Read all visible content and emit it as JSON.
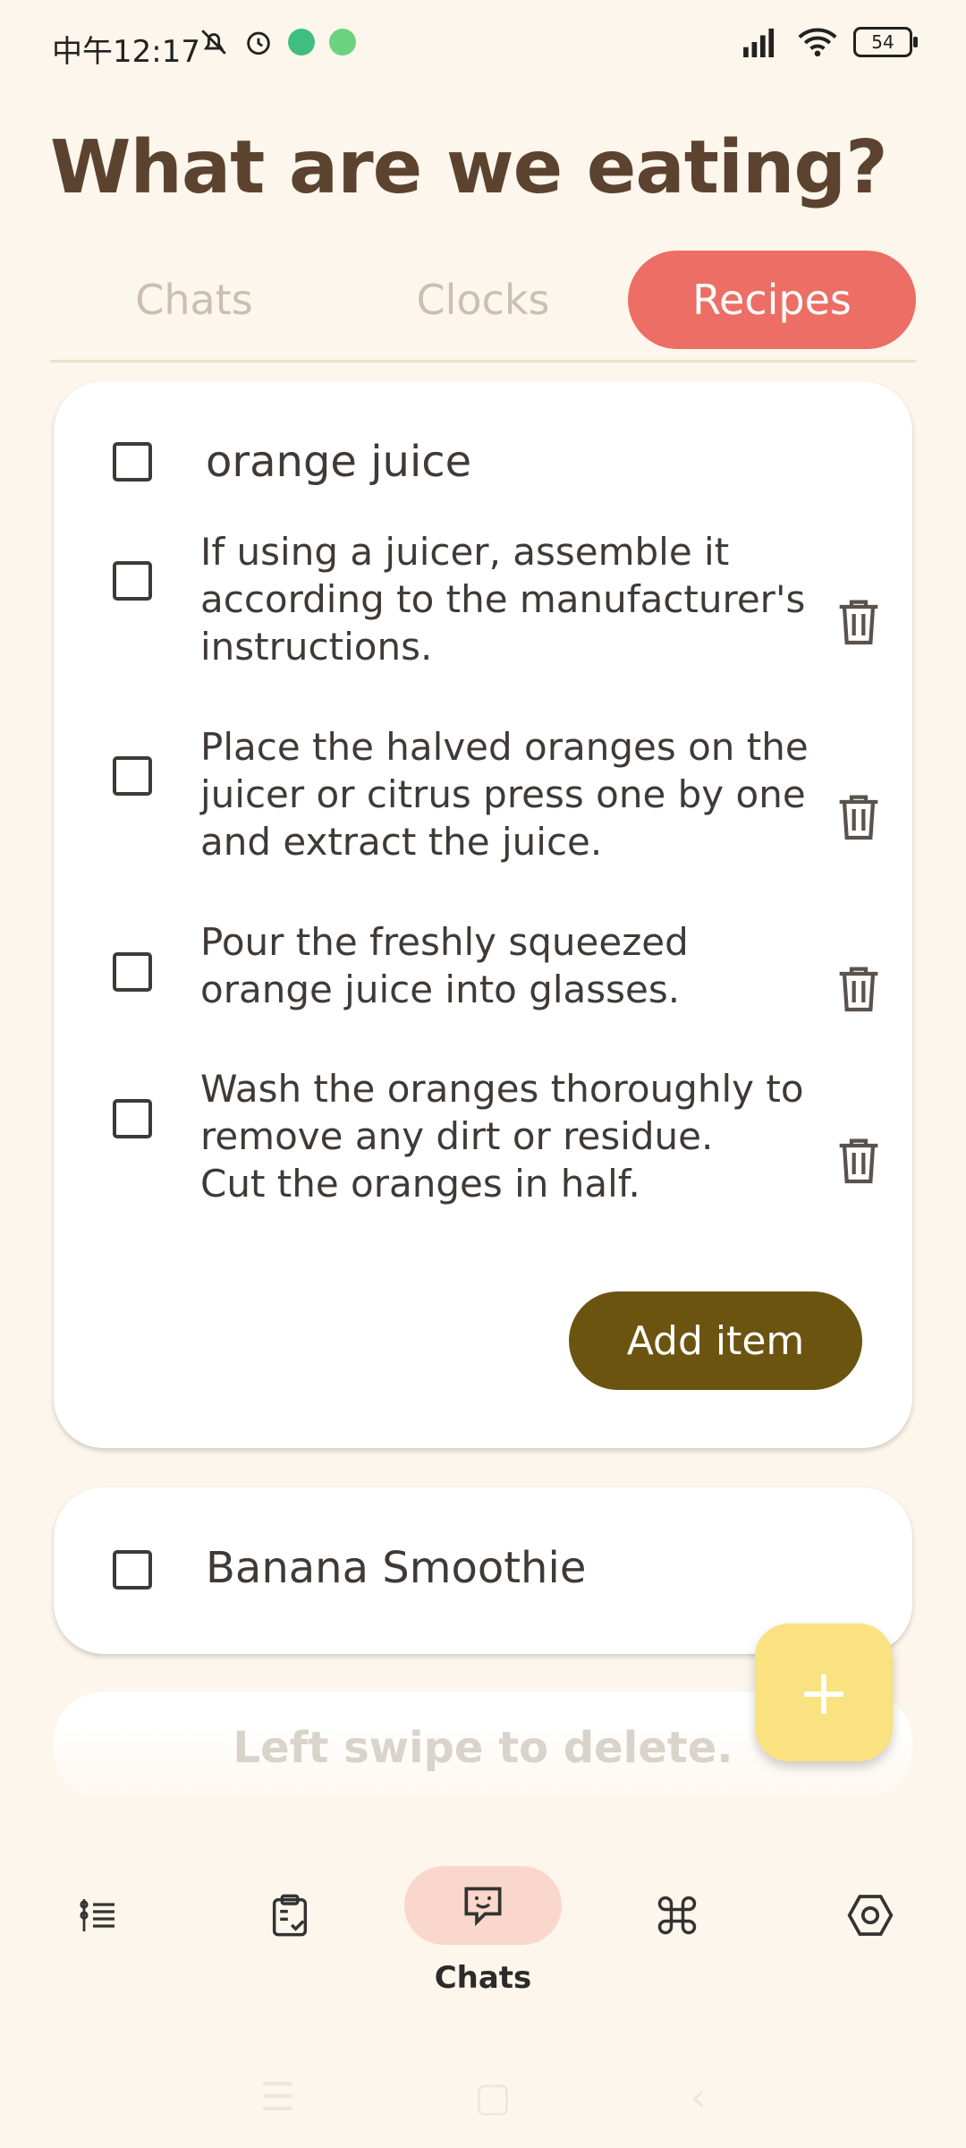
{
  "status_bar": {
    "time": "中午12:17",
    "battery": "54"
  },
  "header": {
    "title": "What are we eating?"
  },
  "tabs": [
    {
      "label": "Chats"
    },
    {
      "label": "Clocks"
    },
    {
      "label": "Recipes"
    }
  ],
  "recipes": [
    {
      "title": "orange juice",
      "steps": [
        {
          "text": "If using a juicer, assemble it\naccording to the manufacturer's\ninstructions."
        },
        {
          "text": "Place the halved oranges on the\njuicer or citrus press one by one\nand extract the juice."
        },
        {
          "text": "Pour the freshly squeezed\norange juice into glasses."
        },
        {
          "text": "Wash the oranges thoroughly to\nremove any dirt or residue.\nCut the oranges in half."
        }
      ],
      "add_label": "Add item"
    },
    {
      "title": "Banana Smoothie"
    }
  ],
  "hint": "Left swipe to delete.",
  "fab": {
    "icon": "plus-icon",
    "label": "+"
  },
  "bottom_nav": {
    "items": [
      {
        "icon": "list-icon"
      },
      {
        "icon": "clipboard-check-icon"
      },
      {
        "icon": "chat-icon",
        "label": "Chats"
      },
      {
        "icon": "apps-icon"
      },
      {
        "icon": "settings-icon"
      }
    ]
  },
  "colors": {
    "background": "#FDF6EC",
    "accent_tab": "#EC6E64",
    "button": "#6B5410",
    "fab": "#F9E27F"
  }
}
